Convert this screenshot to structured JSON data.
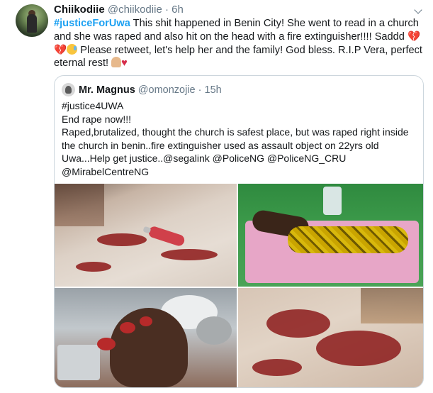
{
  "tweet": {
    "name": "Chiikodiie",
    "handle": "@chiikodiie",
    "separator": "·",
    "time": "6h",
    "hashtag": "#justiceForUwa",
    "text_1": " This shit happened in Benin City! She went to read in a church and she was raped and also hit on the head with a fire extinguisher!!!! Saddd ",
    "broken_hearts": "💔💔",
    "text_2": " Please retweet, let's help her and the family! God bless. R.I.P Vera, perfect eternal rest! ",
    "heart": "♥"
  },
  "quoted": {
    "name": "Mr. Magnus",
    "handle": "@omonzojie",
    "separator": "·",
    "time": "15h",
    "lines": [
      "#justice4UWA",
      "End rape now!!!",
      "Raped,brutalized, thought the church is safest place, but was raped right inside the church in benin..fire extinguisher used as assault object on 22yrs old Uwa...Help get justice..@segalink @PoliceNG @PoliceNG_CRU @MirabelCentreNG"
    ]
  },
  "colors": {
    "link": "#1da1f2",
    "text": "#14171a",
    "muted": "#657786",
    "border": "#ccd6dd"
  },
  "icons": [
    "caret-down-icon",
    "profile-avatar",
    "quoted-avatar"
  ]
}
